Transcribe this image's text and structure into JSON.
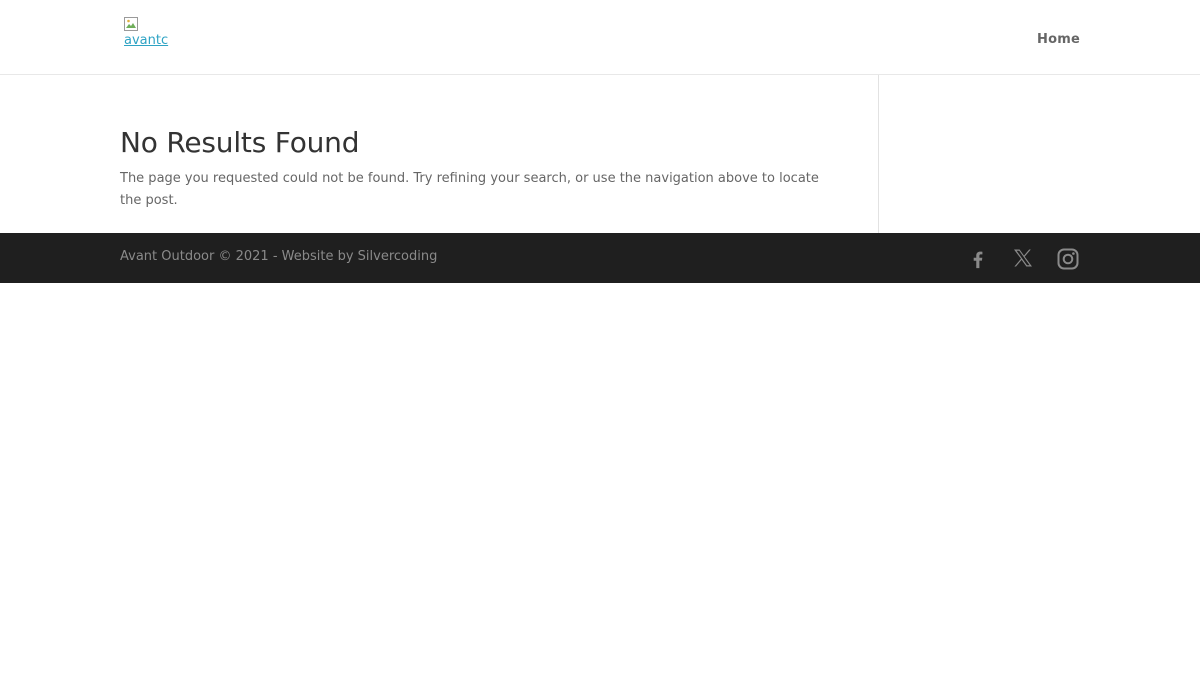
{
  "header": {
    "logo_alt": "avantc",
    "nav": {
      "home_label": "Home"
    }
  },
  "main": {
    "title": "No Results Found",
    "message": "The page you requested could not be found. Try refining your search, or use the navigation above to locate the post."
  },
  "footer": {
    "credits": "Avant Outdoor © 2021 - Website by Silvercoding",
    "social": [
      {
        "icon": "facebook-icon"
      },
      {
        "icon": "x-twitter-icon"
      },
      {
        "icon": "instagram-icon"
      }
    ]
  },
  "colors": {
    "link_accent": "#2ea3c4",
    "footer_bg": "#1f1f1f",
    "footer_text": "#8a8a8a",
    "heading": "#333333",
    "body_text": "#666666"
  }
}
